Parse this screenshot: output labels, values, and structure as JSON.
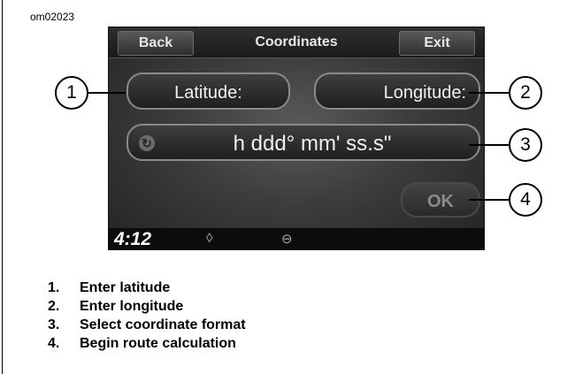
{
  "figure_id": "om02023",
  "screen": {
    "back_label": "Back",
    "title": "Coordinates",
    "exit_label": "Exit",
    "latitude_label": "Latitude:",
    "longitude_label": "Longitude:",
    "format_label": "h ddd° mm' ss.s\"",
    "ok_label": "OK",
    "time": "4:12"
  },
  "callouts": [
    "1",
    "2",
    "3",
    "4"
  ],
  "legend": [
    {
      "num": "1.",
      "text": "Enter latitude"
    },
    {
      "num": "2.",
      "text": "Enter longitude"
    },
    {
      "num": "3.",
      "text": "Select coordinate format"
    },
    {
      "num": "4.",
      "text": "Begin route calculation"
    }
  ]
}
